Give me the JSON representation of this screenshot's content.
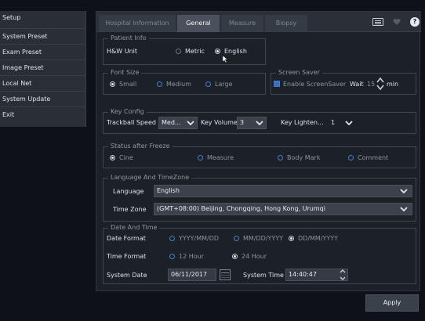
{
  "sidebar": {
    "title": "Setup",
    "items": [
      {
        "label": "System Preset"
      },
      {
        "label": "Exam Preset"
      },
      {
        "label": "Image Preset"
      },
      {
        "label": "Local Net"
      },
      {
        "label": "System  Update"
      },
      {
        "label": "Exit"
      }
    ]
  },
  "tabs": [
    {
      "label": "Hospital Information"
    },
    {
      "label": "General",
      "selected": true
    },
    {
      "label": "Measure"
    },
    {
      "label": "Biopsy"
    }
  ],
  "patient_info": {
    "legend": "Patient Info",
    "label": "H&W Unit",
    "options": [
      "Metric",
      "English"
    ],
    "selected": "English"
  },
  "font_size": {
    "legend": "Font Size",
    "options": [
      "Small",
      "Medium",
      "Large"
    ],
    "selected": "Small"
  },
  "screen_saver": {
    "legend": "Screen Saver",
    "enable_label": "Enable ScreenSaver",
    "enabled": true,
    "wait_label": "Wait",
    "wait_value": "15",
    "unit": "min"
  },
  "key_config": {
    "legend": "Key Config",
    "trackball_label": "Trackball Speed",
    "trackball_value": "Med...",
    "volume_label": "Key Volume",
    "volume_value": "3",
    "lighten_label": "Key Lighten...",
    "lighten_value": "1"
  },
  "freeze": {
    "legend": "Status after Freeze",
    "options": [
      "Cine",
      "Measure",
      "Body Mark",
      "Comment"
    ],
    "selected": "Cine"
  },
  "language": {
    "legend": "Language And TimeZone",
    "language_label": "Language",
    "language_value": "English",
    "timezone_label": "Time Zone",
    "timezone_value": "(GMT+08:00) Beijing, Chongqing, Hong Kong, Urumqi"
  },
  "datetime": {
    "legend": "Date And Time",
    "date_format_label": "Date Format",
    "date_formats": [
      "YYYY/MM/DD",
      "MM/DD/YYYY",
      "DD/MM/YYYY"
    ],
    "date_format_selected": "DD/MM/YYYY",
    "time_format_label": "Time Format",
    "time_formats": [
      "12 Hour",
      "24 Hour"
    ],
    "time_format_selected": "24 Hour",
    "system_date_label": "System Date",
    "system_date_value": "06/11/2017",
    "system_time_label": "System Time",
    "system_time_value": "14:40:47"
  },
  "apply_label": "Apply",
  "colors": {
    "accent": "#3a6fc4",
    "panel": "#1c2027",
    "sidebar": "#2a2f37"
  }
}
